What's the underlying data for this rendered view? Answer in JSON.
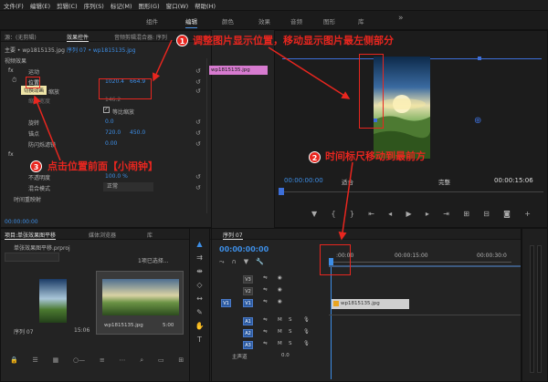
{
  "menu": [
    "文件(F)",
    "编辑(E)",
    "剪辑(C)",
    "序列(S)",
    "标记(M)",
    "图形(G)",
    "窗口(W)",
    "帮助(H)"
  ],
  "workspaces": [
    "组件",
    "编辑",
    "颜色",
    "效果",
    "音频",
    "图形",
    "库"
  ],
  "workspace_active": "编辑",
  "workspace_more": "»",
  "source_panel": {
    "tabs": [
      "源：(无剪辑)",
      "效果控件",
      "音频剪辑混合器: 序列"
    ],
    "master_label": "主要 • wp1815135.jpg",
    "sequence_label": "序列 07 • wp1815135.jpg",
    "clip_name": "wp1815135.jpg",
    "video_effects": "视频效果",
    "motion": "运动",
    "position_label": "位置",
    "position_x": "1020.4",
    "position_y": "664.9",
    "scale_label": "缩放",
    "scale_width_label": "缩放宽度",
    "scale_width_value": "146.2",
    "uniform_scale": "等比缩放",
    "rotation_label": "旋转",
    "rotation_value": "0.0",
    "anchor_label": "锚点",
    "anchor_x": "720.0",
    "anchor_y": "450.0",
    "flicker_label": "防闪烁滤镜",
    "flicker_value": "0.00",
    "opacity_label": "不透明度",
    "opacity_value": "100.0 %",
    "blend_label": "混合模式",
    "blend_value": "正常",
    "time_remap": "时间重映射",
    "tooltip": "切换动画",
    "timecode": "00:00:00:00",
    "fx_label": "fx"
  },
  "program_monitor": {
    "timecode": "00:00:00:00",
    "fit": "适合",
    "quality": "完整",
    "duration": "00:00:15:06"
  },
  "project_panel": {
    "tabs": [
      "项目:单张效果图平移",
      "媒体浏览器",
      "库"
    ],
    "project_file": "单张效果图平移.prproj",
    "selection_info": "1项已选择...",
    "items": [
      {
        "name": "序列 07",
        "duration": "15:06"
      },
      {
        "name": "wp1815135.jpg",
        "duration": "5:00"
      }
    ]
  },
  "timeline": {
    "tab": "序列 07",
    "timecode": "00:00:00:00",
    "ruler": [
      ":00:00",
      "00:00:15:00",
      "00:00:30:0"
    ],
    "tracks": [
      {
        "target": "",
        "name": "V3",
        "type": "video"
      },
      {
        "target": "",
        "name": "V2",
        "type": "video"
      },
      {
        "target": "V1",
        "name": "V1",
        "type": "video"
      },
      {
        "target": "A1",
        "name": "A1",
        "type": "audio"
      },
      {
        "target": "",
        "name": "A2",
        "type": "audio"
      },
      {
        "target": "",
        "name": "A3",
        "type": "audio"
      }
    ],
    "master": "主声道",
    "master_value": "0.0",
    "clip_name": "wp1815135.jpg",
    "track_letters": [
      "M",
      "S"
    ]
  },
  "annotations": {
    "a1_num": "1",
    "a1_text": "调整图片显示位置，移动显示图片最左侧部分",
    "a2_num": "2",
    "a2_text": "时间标尺移动到最前方",
    "a3_num": "3",
    "a3_text": "点击位置前面【小闹钟】"
  },
  "colors": {
    "annotation_red": "#e8261f",
    "accent_blue": "#3d8ee6",
    "clip_pink": "#d77bd0"
  }
}
